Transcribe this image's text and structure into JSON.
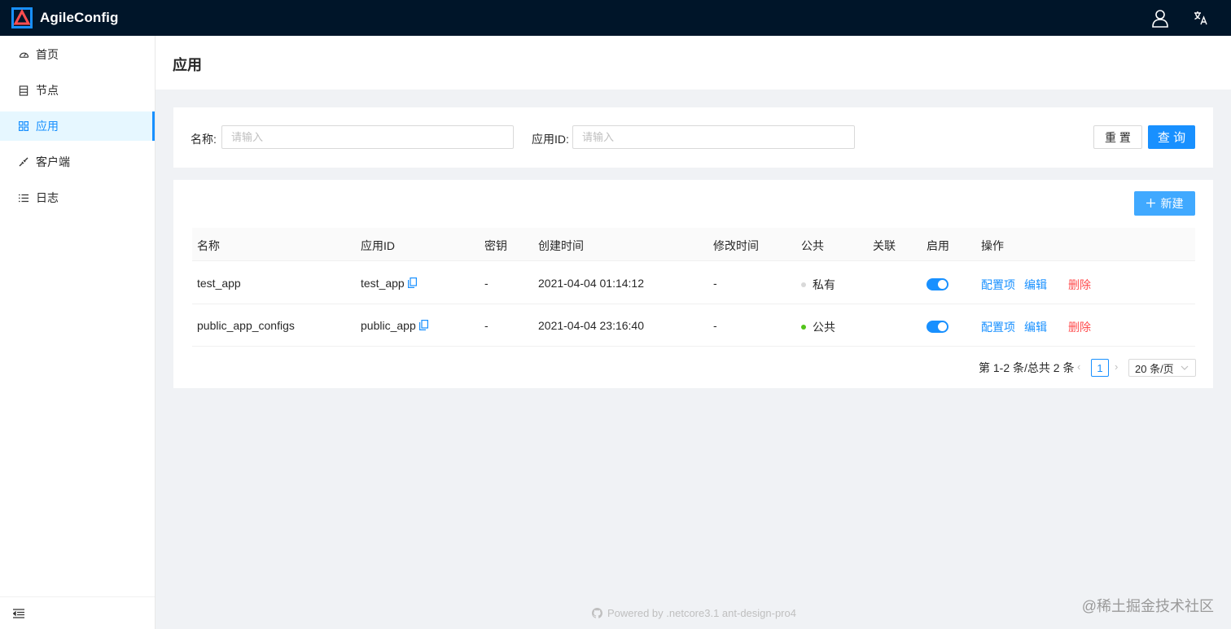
{
  "header": {
    "app_title": "AgileConfig",
    "brand_color": "#001529",
    "logo_color": "#1890ff",
    "logo_accent_color": "#ff4d4f"
  },
  "sidebar": {
    "items": [
      {
        "label": "首页",
        "icon": "dashboard-icon"
      },
      {
        "label": "节点",
        "icon": "database-icon"
      },
      {
        "label": "应用",
        "icon": "appstore-icon",
        "active": true
      },
      {
        "label": "客户端",
        "icon": "plug-icon"
      },
      {
        "label": "日志",
        "icon": "list-icon"
      }
    ],
    "collapse_icon": "menu-fold-icon"
  },
  "page": {
    "title": "应用"
  },
  "search": {
    "name_label": "名称:",
    "name_placeholder": "请输入",
    "appid_label": "应用ID:",
    "appid_placeholder": "请输入",
    "reset_label": "重 置",
    "query_label": "查 询"
  },
  "table": {
    "new_label": "新建",
    "columns": [
      "名称",
      "应用ID",
      "密钥",
      "创建时间",
      "修改时间",
      "公共",
      "关联",
      "启用",
      "操作"
    ],
    "rows": [
      {
        "name": "test_app",
        "app_id": "test_app",
        "secret": "-",
        "created": "2021-04-04 01:14:12",
        "modified": "-",
        "public_label": "私有",
        "public_status_color": "#d9d9d9",
        "relation": "",
        "enabled": true,
        "action_config": "配置项",
        "action_edit": "编辑",
        "action_delete": "删除"
      },
      {
        "name": "public_app_configs",
        "app_id": "public_app",
        "secret": "-",
        "created": "2021-04-04 23:16:40",
        "modified": "-",
        "public_label": "公共",
        "public_status_color": "#52c41a",
        "relation": "",
        "enabled": true,
        "action_config": "配置项",
        "action_edit": "编辑",
        "action_delete": "删除"
      }
    ]
  },
  "pagination": {
    "total_text": "第 1-2 条/总共 2 条",
    "current_page": "1",
    "page_size": "20 条/页"
  },
  "footer": {
    "text": "Powered by .netcore3.1 ant-design-pro4"
  },
  "watermark": "@稀土掘金技术社区"
}
